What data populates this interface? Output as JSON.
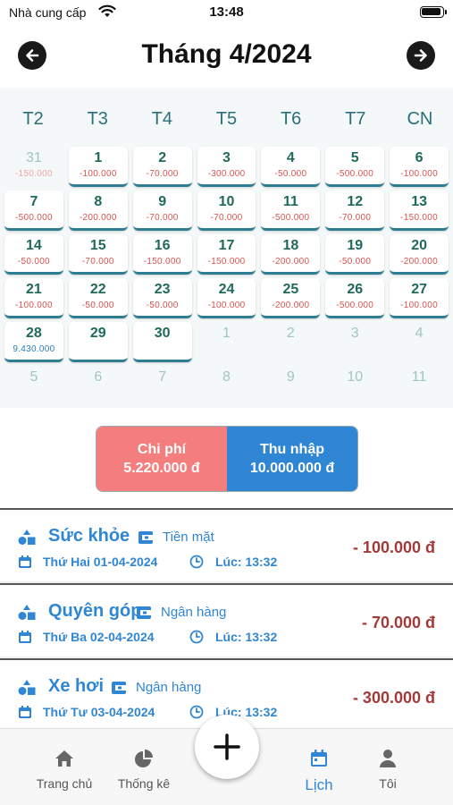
{
  "status_bar": {
    "carrier": "Nhà cung cấp",
    "time": "13:48"
  },
  "header": {
    "title": "Tháng 4/2024"
  },
  "weekdays": [
    "T2",
    "T3",
    "T4",
    "T5",
    "T6",
    "T7",
    "CN"
  ],
  "calendar_rows": [
    [
      {
        "day": "31",
        "amount": "-150.000",
        "kind": "muted"
      },
      {
        "day": "1",
        "amount": "-100.000",
        "kind": "expense"
      },
      {
        "day": "2",
        "amount": "-70.000",
        "kind": "expense"
      },
      {
        "day": "3",
        "amount": "-300.000",
        "kind": "expense"
      },
      {
        "day": "4",
        "amount": "-50.000",
        "kind": "expense"
      },
      {
        "day": "5",
        "amount": "-500.000",
        "kind": "expense"
      },
      {
        "day": "6",
        "amount": "-100.000",
        "kind": "expense"
      }
    ],
    [
      {
        "day": "7",
        "amount": "-500.000",
        "kind": "expense"
      },
      {
        "day": "8",
        "amount": "-200.000",
        "kind": "expense"
      },
      {
        "day": "9",
        "amount": "-70.000",
        "kind": "expense"
      },
      {
        "day": "10",
        "amount": "-70.000",
        "kind": "expense"
      },
      {
        "day": "11",
        "amount": "-500.000",
        "kind": "expense"
      },
      {
        "day": "12",
        "amount": "-70.000",
        "kind": "expense"
      },
      {
        "day": "13",
        "amount": "-150.000",
        "kind": "expense"
      }
    ],
    [
      {
        "day": "14",
        "amount": "-50.000",
        "kind": "expense"
      },
      {
        "day": "15",
        "amount": "-70.000",
        "kind": "expense"
      },
      {
        "day": "16",
        "amount": "-150.000",
        "kind": "expense"
      },
      {
        "day": "17",
        "amount": "-150.000",
        "kind": "expense"
      },
      {
        "day": "18",
        "amount": "-200.000",
        "kind": "expense"
      },
      {
        "day": "19",
        "amount": "-50.000",
        "kind": "expense"
      },
      {
        "day": "20",
        "amount": "-200.000",
        "kind": "expense"
      }
    ],
    [
      {
        "day": "21",
        "amount": "-100.000",
        "kind": "expense"
      },
      {
        "day": "22",
        "amount": "-50.000",
        "kind": "expense"
      },
      {
        "day": "23",
        "amount": "-50.000",
        "kind": "expense"
      },
      {
        "day": "24",
        "amount": "-100.000",
        "kind": "expense"
      },
      {
        "day": "25",
        "amount": "-200.000",
        "kind": "expense"
      },
      {
        "day": "26",
        "amount": "-500.000",
        "kind": "expense"
      },
      {
        "day": "27",
        "amount": "-100.000",
        "kind": "expense"
      }
    ],
    [
      {
        "day": "28",
        "amount": "9.430.000",
        "kind": "income"
      },
      {
        "day": "29",
        "amount": "",
        "kind": "empty"
      },
      {
        "day": "30",
        "amount": "",
        "kind": "empty"
      },
      {
        "day": "1",
        "amount": "",
        "kind": "outside"
      },
      {
        "day": "2",
        "amount": "",
        "kind": "outside"
      },
      {
        "day": "3",
        "amount": "",
        "kind": "outside"
      },
      {
        "day": "4",
        "amount": "",
        "kind": "outside"
      }
    ],
    [
      {
        "day": "5",
        "amount": "",
        "kind": "outside"
      },
      {
        "day": "6",
        "amount": "",
        "kind": "outside"
      },
      {
        "day": "7",
        "amount": "",
        "kind": "outside"
      },
      {
        "day": "8",
        "amount": "",
        "kind": "outside"
      },
      {
        "day": "9",
        "amount": "",
        "kind": "outside"
      },
      {
        "day": "10",
        "amount": "",
        "kind": "outside"
      },
      {
        "day": "11",
        "amount": "",
        "kind": "outside"
      }
    ]
  ],
  "summary": {
    "expense_label": "Chi phí",
    "expense_value": "5.220.000 đ",
    "income_label": "Thu nhập",
    "income_value": "10.000.000 đ"
  },
  "transactions": [
    {
      "category": "Sức khỏe",
      "account": "Tiền mặt",
      "date": "Thứ Hai 01-04-2024",
      "time": "Lúc: 13:32",
      "amount": "- 100.000 đ"
    },
    {
      "category": "Quyên góp",
      "account": "Ngân hàng",
      "date": "Thứ Ba 02-04-2024",
      "time": "Lúc: 13:32",
      "amount": "- 70.000 đ"
    },
    {
      "category": "Xe hơi",
      "account": "Ngân hàng",
      "date": "Thứ Tư 03-04-2024",
      "time": "Lúc: 13:32",
      "amount": "- 300.000 đ"
    }
  ],
  "tabbar": {
    "home": "Trang chủ",
    "stats": "Thống kê",
    "calendar": "Lịch",
    "me": "Tôi"
  },
  "colors": {
    "accent": "#2f86d4",
    "expense": "#f47e7e",
    "teal": "#1f6a5a"
  }
}
